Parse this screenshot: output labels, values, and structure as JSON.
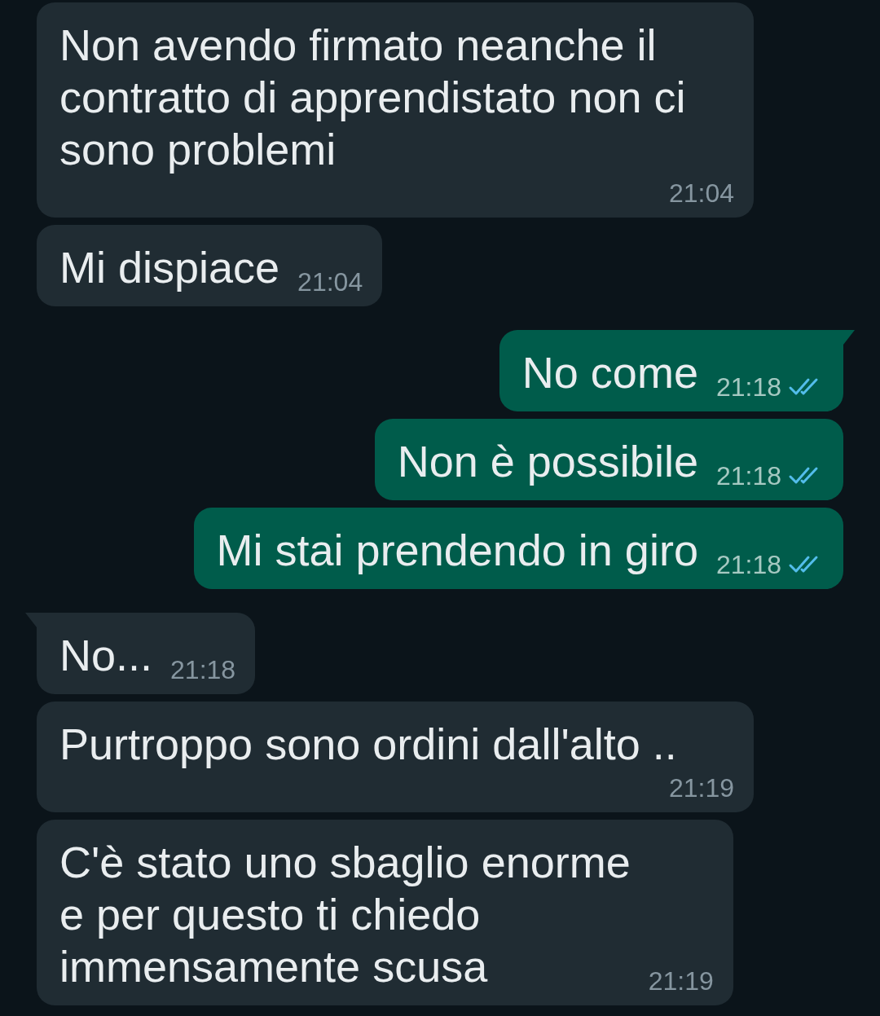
{
  "messages": [
    {
      "kind": "incoming",
      "tail": false,
      "text": "Non avendo firmato neanche il contratto di apprendistato non ci sono problemi",
      "time": "21:04"
    },
    {
      "kind": "incoming",
      "tail": false,
      "text": "Mi dispiace",
      "time": "21:04"
    },
    {
      "kind": "outgoing",
      "tail": true,
      "text": "No come",
      "time": "21:18",
      "read": true
    },
    {
      "kind": "outgoing",
      "tail": false,
      "text": "Non è possibile",
      "time": "21:18",
      "read": true
    },
    {
      "kind": "outgoing",
      "tail": false,
      "text": "Mi stai prendendo in giro",
      "time": "21:18",
      "read": true
    },
    {
      "kind": "incoming",
      "tail": true,
      "text": "No...",
      "time": "21:18"
    },
    {
      "kind": "incoming",
      "tail": false,
      "text": "Purtroppo sono ordini dall'alto ..",
      "time": "21:19"
    },
    {
      "kind": "incoming",
      "tail": false,
      "text": "C'è stato uno sbaglio enorme\ne per questo ti chiedo\nimmensamente scusa",
      "time": "21:19"
    }
  ]
}
